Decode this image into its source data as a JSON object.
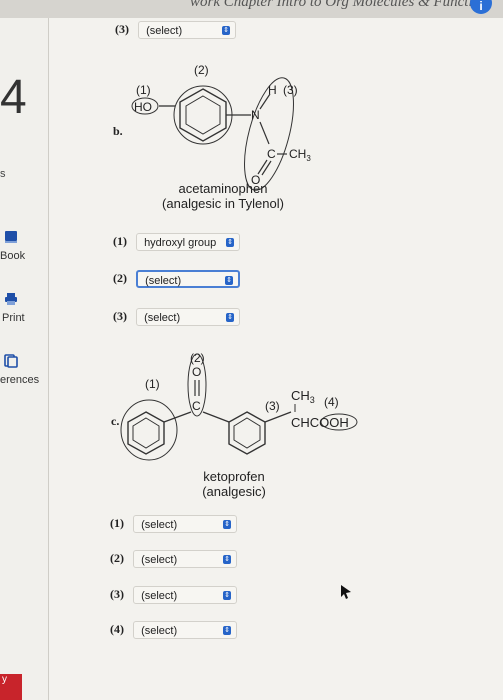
{
  "header": {
    "title": "work Chapter  Intro to Org Molecules & Functio...",
    "info_glyph": "i"
  },
  "sidebar": {
    "chapter_number": "4",
    "partial_letter": "s",
    "items": [
      {
        "label": "Book",
        "icon": "book-icon"
      },
      {
        "label": "Print",
        "icon": "printer-icon"
      },
      {
        "label": "erences",
        "icon": "references-icon"
      }
    ],
    "bottom_badge": "y"
  },
  "top_question": {
    "number": "(3)",
    "value": "(select)"
  },
  "part_b": {
    "label": "b.",
    "structure_labels": {
      "n1": "(1)",
      "n2": "(2)",
      "n3": "(3)",
      "ho": "HO",
      "h": "H",
      "n": "N",
      "c": "C",
      "ch3": "CH",
      "sub3": "3",
      "o": "O"
    },
    "compound_name": "acetaminophen",
    "compound_desc": "(analgesic in Tylenol)",
    "selects": [
      {
        "number": "(1)",
        "value": "hydroxyl group"
      },
      {
        "number": "(2)",
        "value": "(select)"
      },
      {
        "number": "(3)",
        "value": "(select)"
      }
    ]
  },
  "part_c": {
    "label": "c.",
    "structure_labels": {
      "n1": "(1)",
      "n2": "(2)",
      "n3": "(3)",
      "n4": "(4)",
      "o": "O",
      "c": "C",
      "ch3": "CH",
      "sub3": "3",
      "chcooh": "CHCOOH"
    },
    "compound_name": "ketoprofen",
    "compound_desc": "(analgesic)",
    "selects": [
      {
        "number": "(1)",
        "value": "(select)"
      },
      {
        "number": "(2)",
        "value": "(select)"
      },
      {
        "number": "(3)",
        "value": "(select)"
      },
      {
        "number": "(4)",
        "value": "(select)"
      }
    ]
  },
  "colors": {
    "accent": "#2664c8",
    "highlight": "#4a7fd4"
  }
}
